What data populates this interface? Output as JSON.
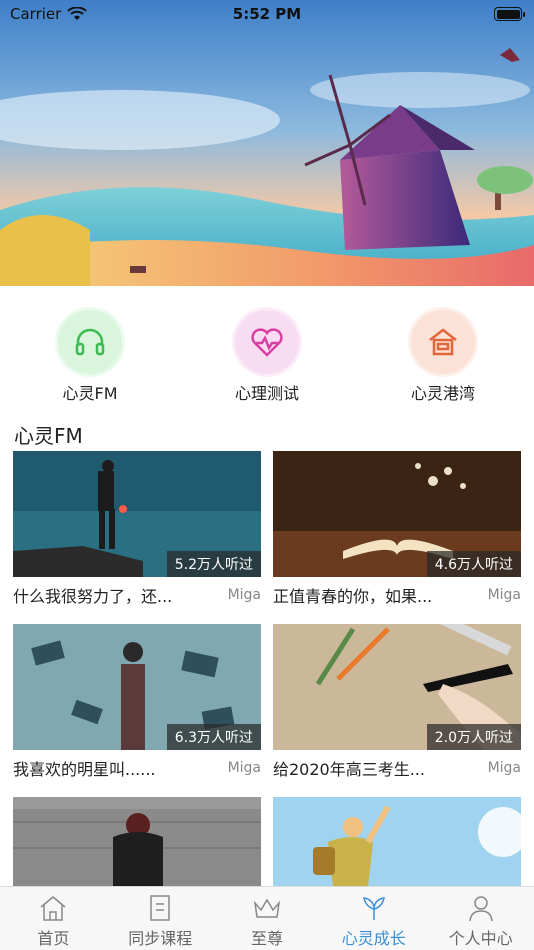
{
  "status_bar": {
    "carrier": "Carrier",
    "time": "5:52 PM"
  },
  "quick_entries": [
    {
      "label": "心灵FM",
      "icon": "headphones-icon",
      "color": "#3cba54"
    },
    {
      "label": "心理测试",
      "icon": "heart-pulse-icon",
      "color": "#d83fa3"
    },
    {
      "label": "心灵港湾",
      "icon": "house-icon",
      "color": "#e3653a"
    }
  ],
  "section": {
    "title": "心灵FM"
  },
  "cards": [
    {
      "title": "什么我很努力了，还...",
      "author": "Miga",
      "plays": "5.2万人听过"
    },
    {
      "title": "正值青春的你，如果...",
      "author": "Miga",
      "plays": "4.6万人听过"
    },
    {
      "title": "我喜欢的明星叫......",
      "author": "Miga",
      "plays": "6.3万人听过"
    },
    {
      "title": "给2020年高三考生...",
      "author": "Miga",
      "plays": "2.0万人听过"
    },
    {
      "title": "",
      "author": "",
      "plays": ""
    },
    {
      "title": "",
      "author": "",
      "plays": ""
    }
  ],
  "tabs": [
    {
      "label": "首页",
      "icon": "home-icon",
      "active": false
    },
    {
      "label": "同步课程",
      "icon": "document-icon",
      "active": false
    },
    {
      "label": "至尊",
      "icon": "crown-icon",
      "active": false
    },
    {
      "label": "心灵成长",
      "icon": "sprout-icon",
      "active": true
    },
    {
      "label": "个人中心",
      "icon": "person-icon",
      "active": false
    }
  ],
  "colors": {
    "accent": "#3a8fd9"
  }
}
